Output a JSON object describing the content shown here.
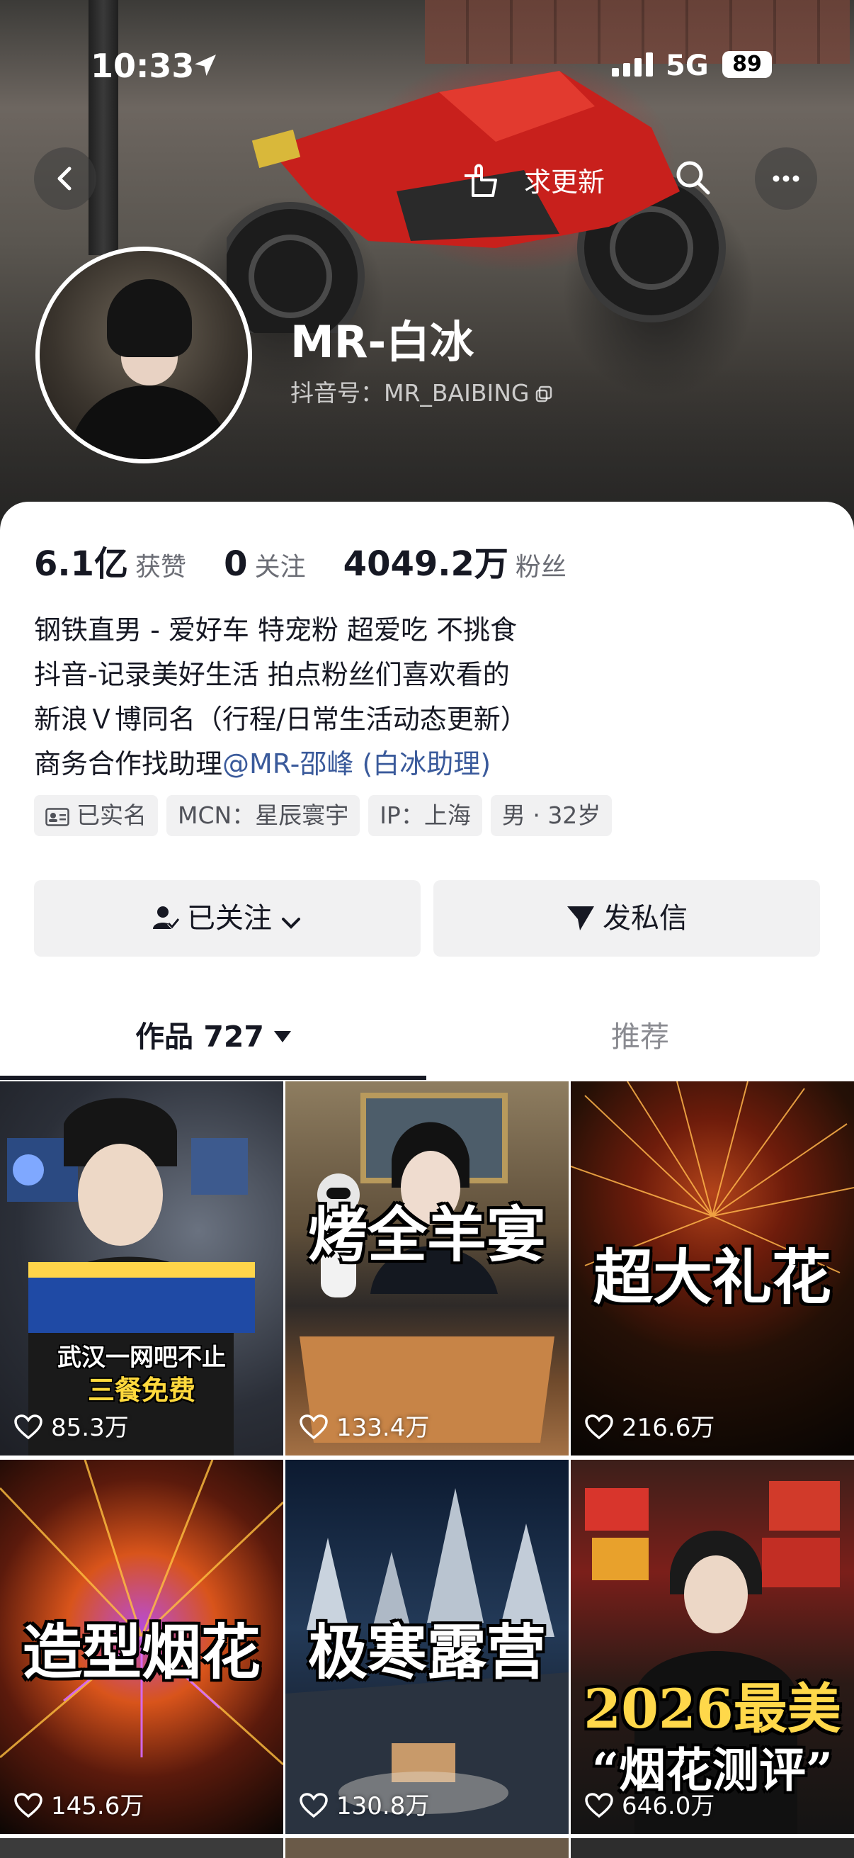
{
  "status_bar": {
    "time": "10:33",
    "network": "5G",
    "battery": "89"
  },
  "header": {
    "urge_update_label": "求更新",
    "nickname": "MR-白冰",
    "account_id": "抖音号：MR_BAIBING"
  },
  "stats": [
    {
      "value": "6.1亿",
      "label": "获赞"
    },
    {
      "value": "0",
      "label": "关注"
    },
    {
      "value": "4049.2万",
      "label": "粉丝"
    }
  ],
  "bio": {
    "lines": [
      "钢铁直男 - 爱好车 特宠粉 超爱吃 不挑食",
      "抖音-记录美好生活 拍点粉丝们喜欢看的",
      "新浪Ｖ博同名（行程/日常生活动态更新）"
    ],
    "business_prefix": "商务合作找助理",
    "mention": "@MR-邵峰 (白冰助理)"
  },
  "tags": [
    "已实名",
    "MCN：星辰寰宇",
    "IP：上海",
    "男 · 32岁"
  ],
  "actions": {
    "follow_label": "已关注",
    "message_label": "发私信"
  },
  "tabs": {
    "works_label": "作品 727",
    "recommend_label": "推荐"
  },
  "videos": [
    {
      "caption": "",
      "overlay_line1": "武汉一网吧不止",
      "overlay_line2": "三餐免费",
      "likes": "85.3万"
    },
    {
      "caption": "烤全羊宴",
      "likes": "133.4万"
    },
    {
      "caption": "超大礼花",
      "likes": "216.6万"
    },
    {
      "caption": "造型烟花",
      "likes": "145.6万"
    },
    {
      "caption": "极寒露营",
      "likes": "130.8万"
    },
    {
      "caption": "2026最美",
      "caption2": "“烟花测评”",
      "likes": "646.0万"
    }
  ],
  "colors": {
    "text_primary": "#161823",
    "mention": "#3a5a9b",
    "tag_bg": "#f1f1f2"
  }
}
